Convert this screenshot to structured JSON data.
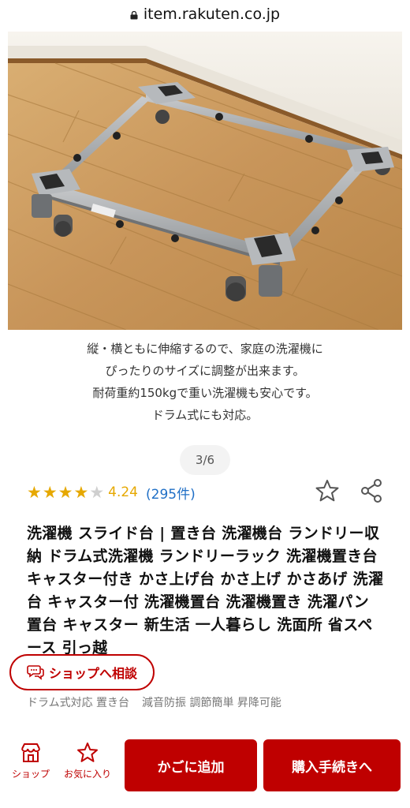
{
  "browser": {
    "url": "item.rakuten.co.jp"
  },
  "gallery": {
    "caption_lines": [
      "縦・横ともに伸縮するので、家庭の洗濯機に",
      "ぴったりのサイズに調整が出来ます。",
      "耐荷重約150kgで重い洗濯機も安心です。",
      "ドラム式にも対応。"
    ],
    "pager": "3/6"
  },
  "rating": {
    "stars": 4.24,
    "score": "4.24",
    "count": "(295件)"
  },
  "product": {
    "title": "洗濯機 スライド台 | 置き台 洗濯機台 ランドリー収納 ドラム式洗濯機 ランドリーラック 洗濯機置き台 キャスター付き かさ上げ台 かさ上げ かさあげ 洗濯台 キャスター付 洗濯機置台 洗濯機置き 洗濯パン 置台 キャスター 新生活 一人暮らし 洗面所 省スペース 引っ越"
  },
  "consult": {
    "label": "ショップへ相談"
  },
  "tags": [
    "ドラム式対応 置き台",
    "減音防振 調節簡単 昇降可能"
  ],
  "bottom_nav": {
    "shop": "ショップ",
    "favorite": "お気に入り",
    "cart": "かごに追加",
    "buy": "購入手続きへ"
  },
  "colors": {
    "accent": "#bf0000",
    "star": "#e6a800",
    "link": "#1f6fc6"
  },
  "icons": [
    "lock-icon",
    "star-outline-icon",
    "share-icon",
    "chat-icon",
    "shop-icon"
  ]
}
